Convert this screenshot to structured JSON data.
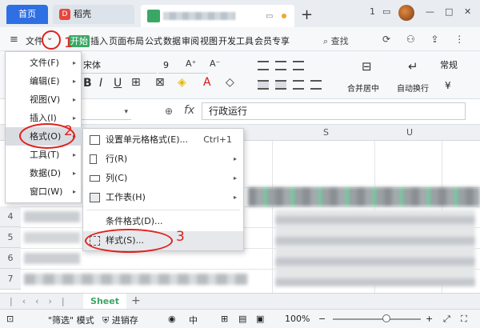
{
  "titlebar": {
    "home_tab": "首页",
    "daoke_tab": "稻壳",
    "daoke_logo": "D",
    "new_tab": "+",
    "right_icons": [
      "1",
      "▭",
      "—",
      "□",
      "✕"
    ]
  },
  "menubar": {
    "hamburger": "≡",
    "file_menu": "文件",
    "chevron": "⌄",
    "ribbon_tabs": [
      "开始",
      "插入",
      "页面布局",
      "公式",
      "数据",
      "审阅",
      "视图",
      "开发工具",
      "会员专享"
    ],
    "search_label": "查找",
    "right_icons": "⟳ ⚇ ⇪ ⋮"
  },
  "toolbar": {
    "font_name": "宋体",
    "font_size": "9",
    "merge_label": "合并居中",
    "wrap_label": "自动换行",
    "number_format": "常规",
    "currency_symbol": "¥"
  },
  "formula_bar": {
    "fx": "fx",
    "zoom_icon": "⊕",
    "value": "行政运行"
  },
  "grid": {
    "columns": [
      "S",
      "U"
    ],
    "rows": [
      "4",
      "5",
      "6",
      "7"
    ]
  },
  "menu1": {
    "items": [
      {
        "label": "文件(F)",
        "submenu": true
      },
      {
        "label": "编辑(E)",
        "submenu": true
      },
      {
        "label": "视图(V)",
        "submenu": true
      },
      {
        "label": "插入(I)",
        "submenu": true
      },
      {
        "label": "格式(O)",
        "submenu": true,
        "active": true
      },
      {
        "label": "工具(T)",
        "submenu": true
      },
      {
        "label": "数据(D)",
        "submenu": true
      },
      {
        "label": "窗口(W)",
        "submenu": true
      }
    ]
  },
  "menu2": {
    "items": [
      {
        "label": "设置单元格格式(E)...",
        "shortcut": "Ctrl+1",
        "icon": "format-cells-icon"
      },
      {
        "label": "行(R)",
        "submenu": true,
        "icon": "row-icon"
      },
      {
        "label": "列(C)",
        "submenu": true,
        "icon": "column-icon"
      },
      {
        "label": "工作表(H)",
        "submenu": true,
        "icon": "worksheet-icon"
      },
      {
        "label": "条件格式(D)..."
      },
      {
        "label": "样式(S)...",
        "icon": "style-icon"
      }
    ]
  },
  "sheets": {
    "active_tab": "Sheet",
    "add": "+"
  },
  "statusbar": {
    "filter_mode": "\"筛选\" 模式",
    "smart_save": "进销存",
    "zoom": "100%",
    "input_lang": "中"
  },
  "annotations": {
    "step1": "1",
    "step2": "2",
    "step3": "3",
    "color": "#e0201d"
  }
}
